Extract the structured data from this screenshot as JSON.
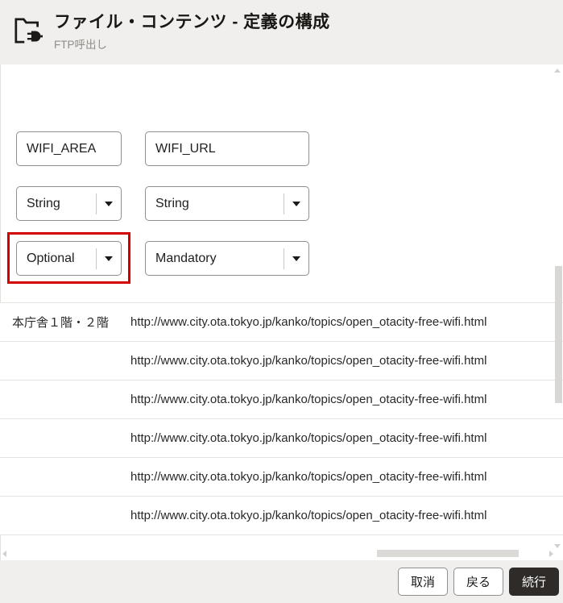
{
  "header": {
    "title": "ファイル・コンテンツ - 定義の構成",
    "subtitle": "FTP呼出し",
    "icon": "folder-plug-icon"
  },
  "form": {
    "element_names": [
      "WIFI_AREA",
      "WIFI_URL"
    ],
    "data_types": [
      "String",
      "String"
    ],
    "requirements": [
      "Optional",
      "Mandatory"
    ]
  },
  "annotation": {
    "type": "red-highlight-box",
    "target": "Optional dropdown",
    "color": "#d40000"
  },
  "table": {
    "rows": [
      {
        "area": "本庁舎１階・２階",
        "url": "http://www.city.ota.tokyo.jp/kanko/topics/open_otacity-free-wifi.html"
      },
      {
        "area": "",
        "url": "http://www.city.ota.tokyo.jp/kanko/topics/open_otacity-free-wifi.html"
      },
      {
        "area": "",
        "url": "http://www.city.ota.tokyo.jp/kanko/topics/open_otacity-free-wifi.html"
      },
      {
        "area": "",
        "url": "http://www.city.ota.tokyo.jp/kanko/topics/open_otacity-free-wifi.html"
      },
      {
        "area": "",
        "url": "http://www.city.ota.tokyo.jp/kanko/topics/open_otacity-free-wifi.html"
      },
      {
        "area": "",
        "url": "http://www.city.ota.tokyo.jp/kanko/topics/open_otacity-free-wifi.html"
      }
    ]
  },
  "footer": {
    "cancel_label": "取消",
    "back_label": "戻る",
    "continue_label": "続行"
  },
  "colors": {
    "header_bg": "#f1efed",
    "footer_bg": "#f1efed",
    "primary_button_bg": "#2e2b28",
    "annotation_red": "#d40000",
    "field_border": "#8f8f8f",
    "row_divider": "#e7e4e0",
    "subtitle_text": "#8f8c88",
    "text": "#1c1a18"
  }
}
